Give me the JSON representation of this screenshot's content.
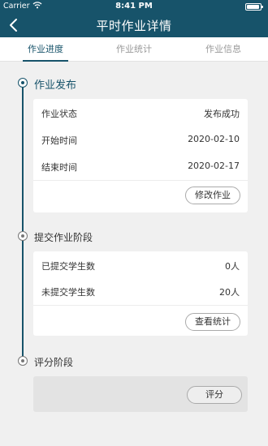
{
  "status_bar": {
    "carrier": "Carrier",
    "time": "8:41 PM"
  },
  "nav": {
    "title": "平时作业详情"
  },
  "tabs": [
    {
      "label": "作业进度",
      "active": true
    },
    {
      "label": "作业统计",
      "active": false
    },
    {
      "label": "作业信息",
      "active": false
    }
  ],
  "stages": {
    "publish": {
      "title": "作业发布",
      "rows": [
        {
          "label": "作业状态",
          "value": "发布成功"
        },
        {
          "label": "开始时间",
          "value": "2020-02-10"
        },
        {
          "label": "结束时间",
          "value": "2020-02-17"
        }
      ],
      "button": "修改作业"
    },
    "submit": {
      "title": "提交作业阶段",
      "rows": [
        {
          "label": "已提交学生数",
          "value": "0人"
        },
        {
          "label": "未提交学生数",
          "value": "20人"
        }
      ],
      "button": "查看统计"
    },
    "grading": {
      "title": "评分阶段",
      "button": "评分"
    }
  },
  "colors": {
    "primary": "#17536a",
    "background": "#f0f0f0"
  }
}
